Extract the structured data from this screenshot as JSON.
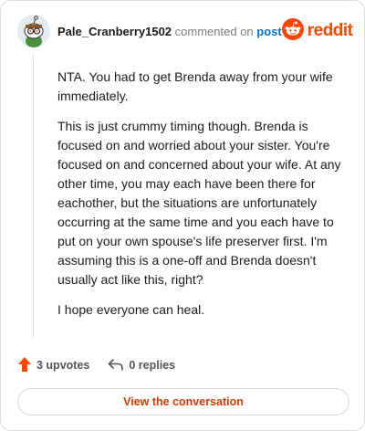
{
  "header": {
    "username": "Pale_Cranberry1502",
    "action_text": "commented on",
    "post_link_label": "post",
    "brand_name": "reddit",
    "avatar_icon": "snoo-avatar-icon",
    "brand_icon": "reddit-snoo-icon"
  },
  "comment": {
    "paragraphs": [
      "NTA. You had to get Brenda away from your wife immediately.",
      "This is just crummy timing though. Brenda is focused on and worried about your sister. You're focused on and concerned about your wife. At any other time, you may each have been there for eachother, but the situations are unfortunately occurring at the same time and you each have to put on your own spouse's life preserver first. I'm assuming this is a one-off and Brenda doesn't usually act like this, right?",
      "I hope everyone can heal."
    ]
  },
  "actions": {
    "upvotes_label": "3 upvotes",
    "replies_label": "0 replies",
    "upvote_icon": "upvote-arrow-icon",
    "reply_icon": "reply-arrow-icon"
  },
  "footer": {
    "view_button_label": "View the conversation"
  },
  "colors": {
    "brand": "#ff4500",
    "link": "#0079d3",
    "button_text": "#d93a00"
  }
}
